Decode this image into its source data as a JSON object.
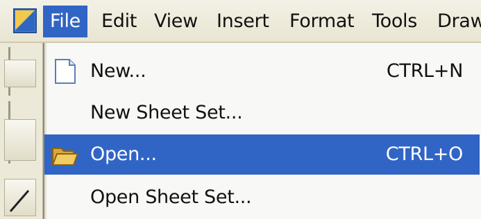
{
  "menubar": {
    "items": [
      {
        "label": "File",
        "active": true
      },
      {
        "label": "Edit"
      },
      {
        "label": "View"
      },
      {
        "label": "Insert"
      },
      {
        "label": "Format"
      },
      {
        "label": "Tools"
      },
      {
        "label": "Draw"
      }
    ]
  },
  "file_menu": {
    "items": [
      {
        "label": "New...",
        "shortcut": "CTRL+N",
        "icon": "new-document-icon"
      },
      {
        "label": "New Sheet Set...",
        "shortcut": ""
      },
      {
        "label": "Open...",
        "shortcut": "CTRL+O",
        "icon": "open-folder-icon",
        "highlighted": true
      },
      {
        "label": "Open Sheet Set...",
        "shortcut": ""
      }
    ]
  },
  "colors": {
    "highlight": "#3165c5",
    "menubar_bg": "#ece9d8"
  }
}
